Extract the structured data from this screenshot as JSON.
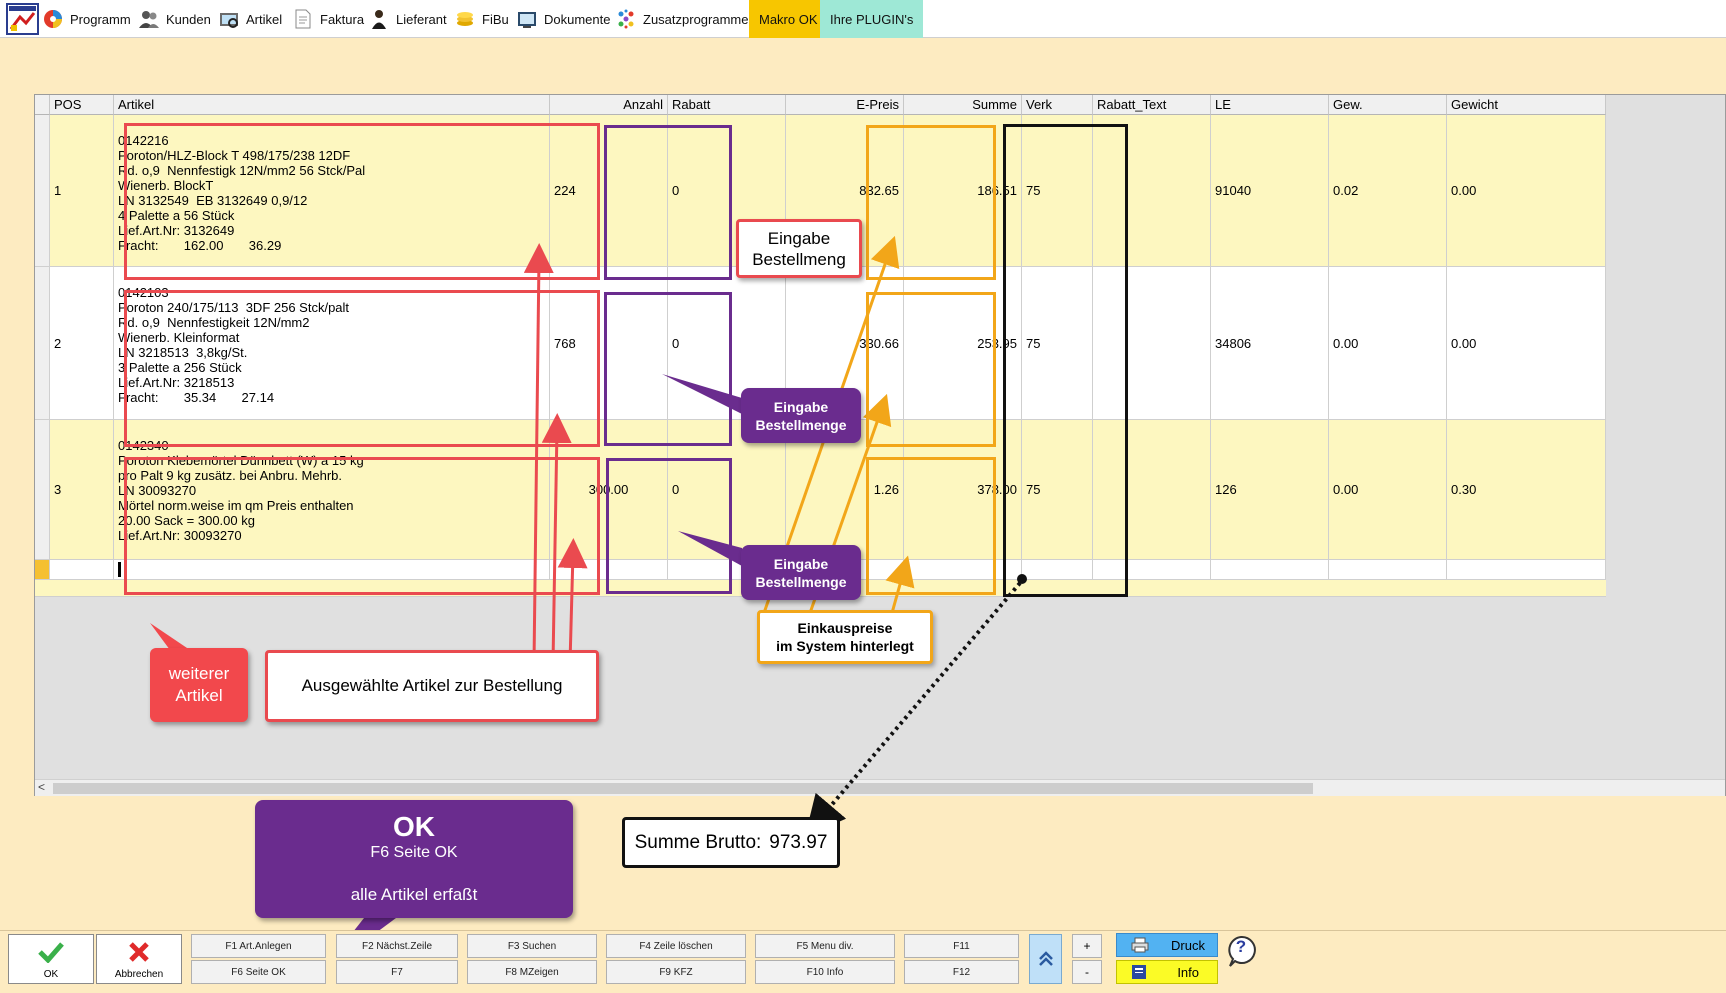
{
  "menubar": {
    "items": [
      {
        "label": "Programm",
        "icon": "program-icon"
      },
      {
        "label": "Kunden",
        "icon": "customers-icon"
      },
      {
        "label": "Artikel",
        "icon": "articles-icon"
      },
      {
        "label": "Faktura",
        "icon": "invoice-icon"
      },
      {
        "label": "Lieferant",
        "icon": "supplier-icon"
      },
      {
        "label": "FiBu",
        "icon": "accounting-icon"
      },
      {
        "label": "Dokumente",
        "icon": "documents-icon"
      },
      {
        "label": "Zusatzprogramme",
        "icon": "addons-icon"
      }
    ],
    "macro_label": "Makro OK",
    "plugin_label": "Ihre PLUGIN's",
    "colors": {
      "macro": "#f7c600",
      "plugin": "#9ee8d6"
    }
  },
  "grid": {
    "columns": [
      "POS",
      "Artikel",
      "Anzahl",
      "Rabatt",
      "E-Preis",
      "Summe",
      "Verk",
      "Rabatt_Text",
      "LE",
      "Gew.",
      "Gewicht"
    ],
    "rows": [
      {
        "pos": "1",
        "artikel": "0142216\nPoroton/HLZ-Block T 498/175/238 12DF\nRd. o,9  Nennfestigk 12N/mm2 56 Stck/Pal\nWienerb. BlockT\nLN 3132549  EB 3132649 0,9/12\n4 Palette a 56 Stück\nLief.Art.Nr: 3132649\nFracht:       162.00       36.29",
        "anzahl": "224",
        "rabatt": "0",
        "epreis": "832.65",
        "summe": "186.51",
        "verk": "75",
        "rabatt_text": "",
        "le": "91040",
        "gew": "0.02",
        "gewicht": "0.00"
      },
      {
        "pos": "2",
        "artikel": "0142103\nPoroton 240/175/113  3DF 256 Stck/palt\nRd. o,9  Nennfestigkeit 12N/mm2\nWienerb. Kleinformat\nLN 3218513  3,8kg/St.\n3 Palette a 256 Stück\nLief.Art.Nr: 3218513\nFracht:       35.34       27.14",
        "anzahl": "768",
        "rabatt": "0",
        "epreis": "330.66",
        "summe": "253.95",
        "verk": "75",
        "rabatt_text": "",
        "le": "34806",
        "gew": "0.00",
        "gewicht": "0.00"
      },
      {
        "pos": "3",
        "artikel": "0142340\nPoroton Klebemörtel Dünnbett (W) a 15 kg\npro Palt 9 kg zusätz. bei Anbru. Mehrb.\nLN 30093270\nMörtel norm.weise im qm Preis enthalten\n20.00 Sack = 300.00 kg\nLief.Art.Nr: 30093270",
        "anzahl": "300.00",
        "rabatt": "0",
        "epreis": "1.26",
        "summe": "378.00",
        "verk": "75",
        "rabatt_text": "",
        "le": "126",
        "gew": "0.00",
        "gewicht": "0.30"
      }
    ]
  },
  "annotations": {
    "eingabe_white": "Eingabe\nBestellmeng",
    "eingabe_purple": "Eingabe\nBestellmenge",
    "einkauf": "Einkauspreise\nim System hinterlegt",
    "weiterer": "weiterer\nArtikel",
    "ausgewaehlt": "Ausgewählte Artikel zur Bestellung",
    "summe_brutto_label": "Summe Brutto:",
    "summe_brutto_value": "973.97",
    "ok_title": "OK",
    "ok_line1": "F6 Seite OK",
    "ok_line2": "alle Artikel erfaßt"
  },
  "toolbar": {
    "ok_label": "OK",
    "cancel_label": "Abbrechen",
    "fkeys_top": [
      "F1 Art.Anlegen",
      "F2 Nächst.Zeile",
      "F3 Suchen",
      "F4 Zeile löschen",
      "F5 Menu div.",
      "F11"
    ],
    "fkeys_bottom": [
      "F6 Seite OK",
      "F7",
      "F8 MZeigen",
      "F9 KFZ",
      "F10 Info",
      "F12"
    ],
    "plus": "+",
    "minus": "-",
    "druck_label": "Druck",
    "info_label": "Info",
    "help_symbol": "?"
  }
}
